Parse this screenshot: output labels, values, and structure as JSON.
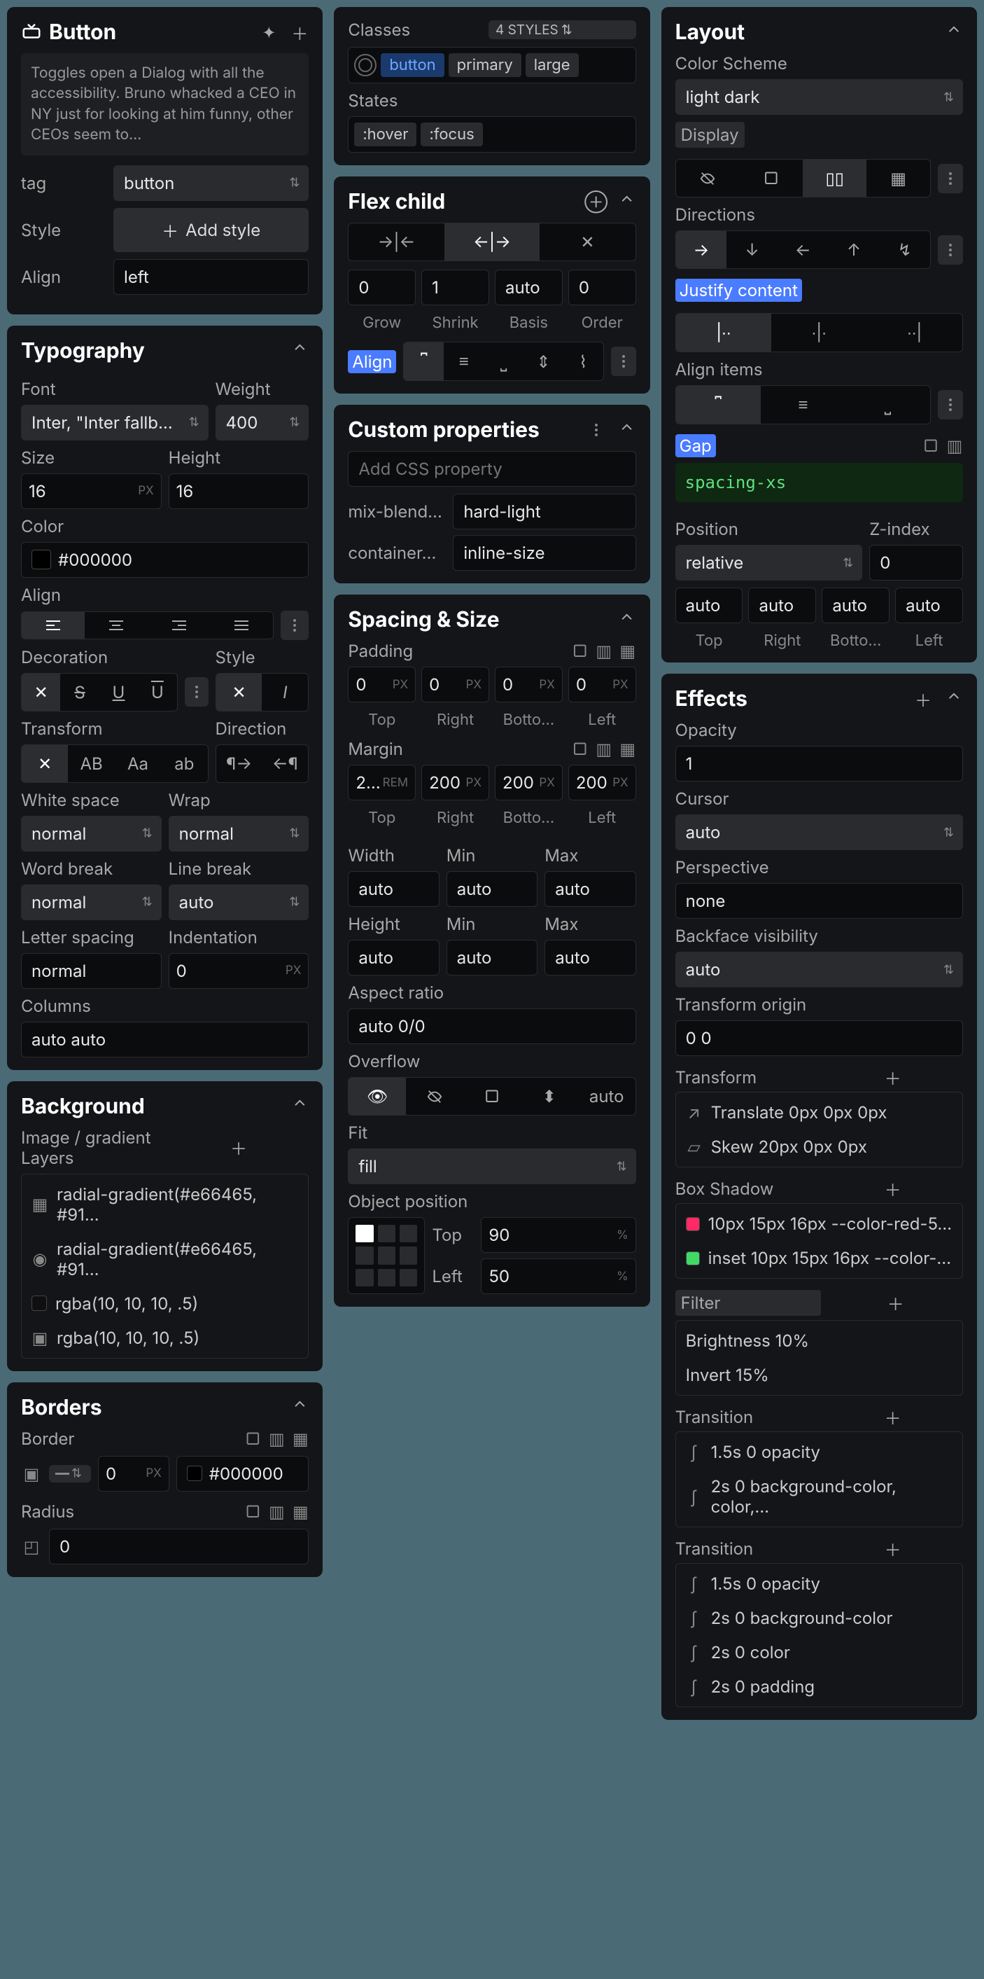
{
  "header": {
    "title": "Button",
    "desc": "Toggles open a Dialog with all the accessibility. Bruno whacked a CEO in NY just for looking at him funny, other CEOs seem to…",
    "tag_label": "tag",
    "tag_value": "button",
    "style_label": "Style",
    "add_style": "Add style",
    "align_label": "Align",
    "align_value": "left"
  },
  "typo": {
    "title": "Typography",
    "font_label": "Font",
    "font_value": "Inter, \"Inter fallb…",
    "weight_label": "Weight",
    "weight_value": "400",
    "size_label": "Size",
    "size_value": "16",
    "size_unit": "PX",
    "height_label": "Height",
    "height_value": "16",
    "color_label": "Color",
    "color_value": "#000000",
    "align_label": "Align",
    "deco_label": "Decoration",
    "style_label": "Style",
    "transform_label": "Transform",
    "direction_label": "Direction",
    "ws_label": "White space",
    "ws_value": "normal",
    "wrap_label": "Wrap",
    "wrap_value": "normal",
    "wb_label": "Word break",
    "wb_value": "normal",
    "lb_label": "Line break",
    "lb_value": "auto",
    "ls_label": "Letter spacing",
    "ls_value": "normal",
    "ind_label": "Indentation",
    "ind_value": "0",
    "ind_unit": "PX",
    "cols_label": "Columns",
    "cols_value": "auto auto"
  },
  "bg": {
    "title": "Background",
    "layers_label": "Image / gradient Layers",
    "l1": "radial-gradient(#e66465, #91…",
    "l2": "radial-gradient(#e66465, #91…",
    "l3": "rgba(10, 10, 10, .5)",
    "l4": "rgba(10, 10, 10, .5)"
  },
  "borders": {
    "title": "Borders",
    "border_label": "Border",
    "width_value": "0",
    "width_unit": "PX",
    "color_value": "#000000",
    "radius_label": "Radius",
    "radius_value": "0"
  },
  "classes": {
    "title": "Classes",
    "styles_badge": "4 STYLES",
    "c1": "button",
    "c2": "primary",
    "c3": "large",
    "states_label": "States",
    "s1": ":hover",
    "s2": ":focus"
  },
  "flex": {
    "title": "Flex child",
    "grow_value": "0",
    "grow_label": "Grow",
    "shrink_value": "1",
    "shrink_label": "Shrink",
    "basis_value": "auto",
    "basis_label": "Basis",
    "order_value": "0",
    "order_label": "Order",
    "align_label": "Align"
  },
  "custom": {
    "title": "Custom properties",
    "placeholder": "Add CSS property",
    "p1_name": "mix-blend…",
    "p1_value": "hard-light",
    "p2_name": "container…",
    "p2_value": "inline-size"
  },
  "spacing": {
    "title": "Spacing & Size",
    "padding_label": "Padding",
    "pt": "0",
    "pr": "0",
    "pb": "0",
    "pl": "0",
    "margin_label": "Margin",
    "mt_val": "2…",
    "mt_unit": "REM",
    "mr_val": "200",
    "mb_val": "200",
    "ml_val": "200",
    "top_label": "Top",
    "right_label": "Right",
    "bottom_label": "Botto…",
    "left_label": "Left",
    "width_label": "Width",
    "min_label": "Min",
    "max_label": "Max",
    "height_label": "Height",
    "auto": "auto",
    "aspect_label": "Aspect ratio",
    "aspect_value": "auto 0/0",
    "overflow_label": "Overflow",
    "overflow_auto": "auto",
    "fit_label": "Fit",
    "fit_value": "fill",
    "objpos_label": "Object position",
    "op_top_label": "Top",
    "op_top_value": "90",
    "op_left_label": "Left",
    "op_left_value": "50",
    "percent": "%"
  },
  "layout": {
    "title": "Layout",
    "scheme_label": "Color Scheme",
    "scheme_value": "light dark",
    "display_label": "Display",
    "dir_label": "Directions",
    "justify_label": "Justify content",
    "align_label": "Align items",
    "gap_label": "Gap",
    "gap_value": "spacing-xs",
    "pos_label": "Position",
    "pos_value": "relative",
    "z_label": "Z-index",
    "z_value": "0",
    "auto": "auto",
    "top_label": "Top",
    "right_label": "Right",
    "bottom_label": "Botto…",
    "left_label": "Left"
  },
  "effects": {
    "title": "Effects",
    "opacity_label": "Opacity",
    "opacity_value": "1",
    "cursor_label": "Cursor",
    "cursor_value": "auto",
    "persp_label": "Perspective",
    "persp_value": "none",
    "bfv_label": "Backface visibility",
    "bfv_value": "auto",
    "to_label": "Transform origin",
    "to_value": "0 0",
    "transform_label": "Transform",
    "t1": "Translate 0px 0px 0px",
    "t2": "Skew 20px 0px 0px",
    "bs_label": "Box Shadow",
    "bs1": "10px 15px 16px --color-red-5…",
    "bs2": "inset 10px 15px 16px --color-…",
    "filter_label": "Filter",
    "f1": "Brightness 10%",
    "f2": "Invert 15%",
    "trans_label": "Transition",
    "tr1": "1.5s 0 opacity",
    "tr2": "2s 0 background-color, color,…",
    "tr3": "1.5s 0 opacity",
    "tr4": "2s 0 background-color",
    "tr5": "2s 0 color",
    "tr6": "2s 0 padding"
  },
  "px": "PX"
}
